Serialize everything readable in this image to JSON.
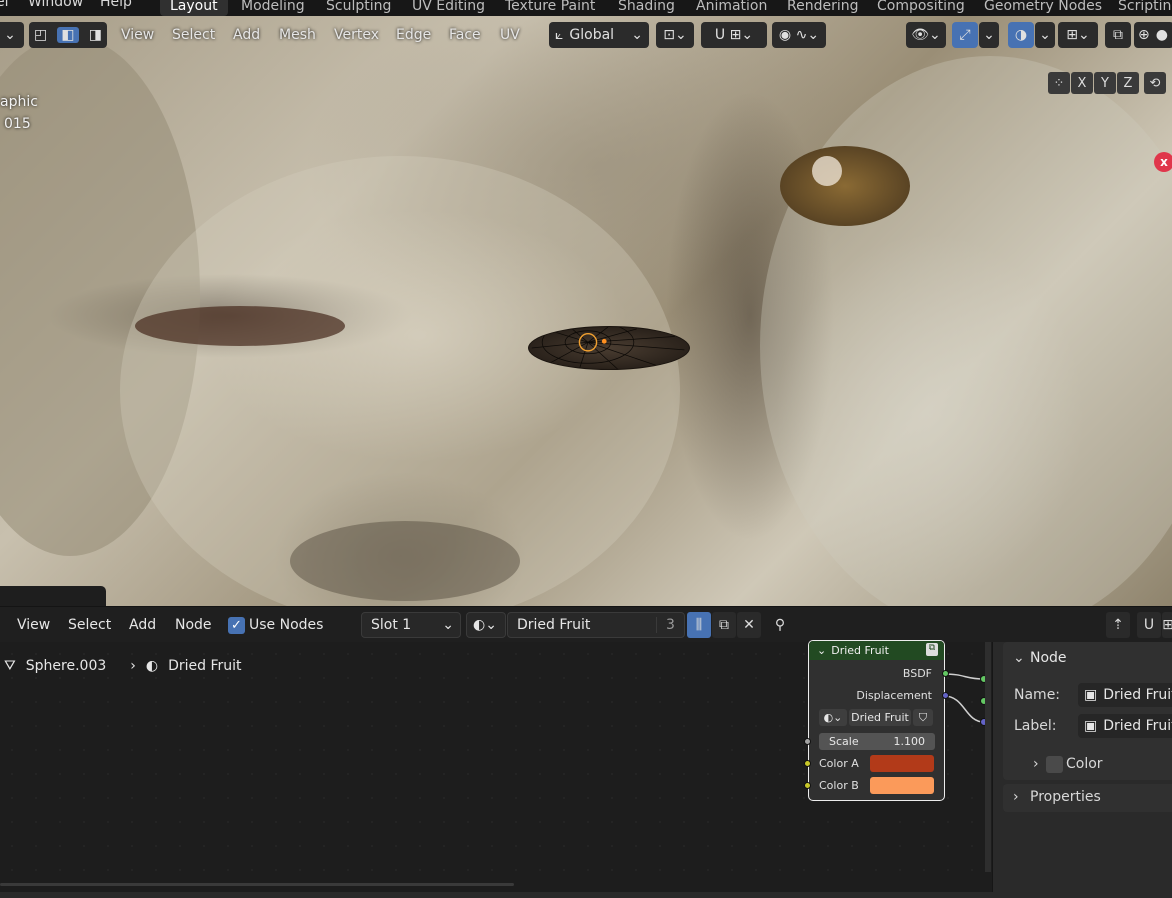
{
  "topbar": {
    "menus": [
      "el",
      "Window",
      "Help"
    ],
    "tabs": [
      "Layout",
      "Modeling",
      "Sculpting",
      "UV Editing",
      "Texture Paint",
      "Shading",
      "Animation",
      "Rendering",
      "Compositing",
      "Geometry Nodes",
      "Scripting"
    ],
    "active_tab": "Layout"
  },
  "viewport": {
    "menus": [
      "View",
      "Select",
      "Add",
      "Mesh",
      "Vertex",
      "Edge",
      "Face",
      "UV"
    ],
    "transform_orientation": "Global",
    "axis_buttons": [
      "X",
      "Y",
      "Z"
    ],
    "overlay_text_1": "aphic",
    "overlay_text_2": "015",
    "close_label": "x"
  },
  "node_editor": {
    "menus": [
      "View",
      "Select",
      "Add",
      "Node"
    ],
    "use_nodes_label": "Use Nodes",
    "use_nodes_checked": true,
    "slot": "Slot 1",
    "material_name": "Dried Fruit",
    "user_count": "3",
    "breadcrumb": {
      "object": "Sphere.003",
      "material": "Dried Fruit"
    }
  },
  "node": {
    "title": "Dried Fruit",
    "outputs": [
      "BSDF",
      "Displacement"
    ],
    "datablock": "Dried Fruit",
    "scale_label": "Scale",
    "scale_value": "1.100",
    "color_a_label": "Color A",
    "color_a": "#b23a19",
    "color_b_label": "Color B",
    "color_b": "#fb9a5a"
  },
  "sidebar": {
    "panel_title": "Node",
    "name_label": "Name:",
    "name_value": "Dried Fruit",
    "label_label": "Label:",
    "label_value": "Dried Fruit",
    "color_label": "Color",
    "properties_label": "Properties"
  },
  "colors": {
    "accent": "#4772b3",
    "node_header": "#224a22",
    "socket_shader": "#63c763",
    "socket_vector": "#6363c7",
    "socket_float": "#a1a1a1",
    "socket_color": "#c7c729"
  }
}
